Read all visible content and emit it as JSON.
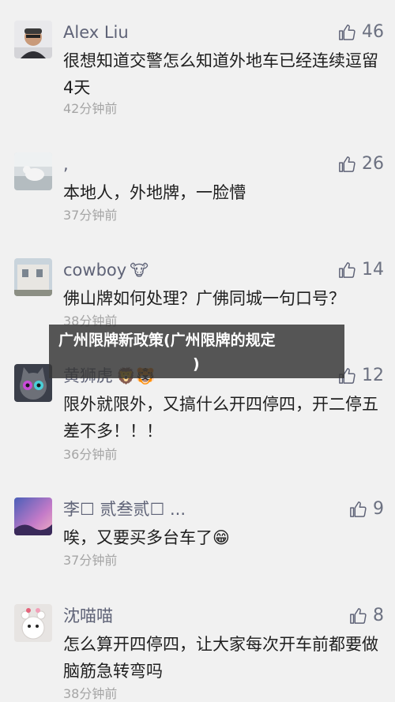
{
  "comments": [
    {
      "name": "Alex Liu",
      "likes": "46",
      "text": "很想知道交警怎么知道外地车已经连续逗留4天",
      "time": "42分钟前",
      "name_suffix": ""
    },
    {
      "name": ",",
      "likes": "26",
      "text": "本地人，外地牌，一脸懵",
      "time": "37分钟前",
      "name_suffix": ""
    },
    {
      "name": "cowboy",
      "likes": "14",
      "text": "佛山牌如何处理？广佛同城一句口号？",
      "time": "38分钟前",
      "name_suffix": "🐮"
    },
    {
      "name": "黄狮虎",
      "likes": "12",
      "text": "限外就限外，又搞什么开四停四，开二停五差不多！！！",
      "time": "36分钟前",
      "name_suffix": "🦁🐯"
    },
    {
      "name": "李☐ 贰叁贰☐ ...",
      "likes": "9",
      "text": "唉，又要买多台车了😁",
      "time": "37分钟前",
      "name_suffix": ""
    },
    {
      "name": "沈喵喵",
      "likes": "8",
      "text": "怎么算开四停四，让大家每次开车前都要做脑筋急转弯吗",
      "time": "38分钟前",
      "name_suffix": ""
    }
  ],
  "overlay": {
    "line1": "广州限牌新政策(广州限牌的规定",
    "line2": ")"
  },
  "icons": {
    "like": "thumbs-up-icon"
  }
}
